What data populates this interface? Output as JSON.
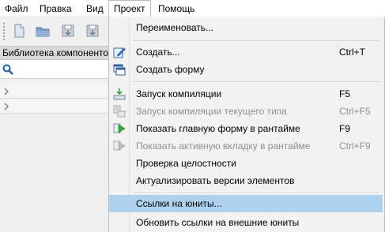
{
  "menubar": {
    "items": [
      {
        "label": "Файл"
      },
      {
        "label": "Правка"
      },
      {
        "label": "Вид"
      },
      {
        "label": "Проект"
      },
      {
        "label": "Помощь"
      }
    ]
  },
  "toolbar": {
    "buttons": [
      "new-file-icon",
      "open-folder-icon",
      "save-icon",
      "save-all-icon"
    ]
  },
  "library": {
    "title": "Библиотека компоненто",
    "search_value": "",
    "search_icon": "search-icon"
  },
  "project_menu": {
    "items": [
      {
        "label": "Переименовать...",
        "shortcut": "",
        "icon": "",
        "enabled": true
      },
      {
        "label": "Создать...",
        "shortcut": "Ctrl+T",
        "icon": "new-edit-icon",
        "enabled": true
      },
      {
        "label": "Создать форму",
        "shortcut": "",
        "icon": "new-form-icon",
        "enabled": true
      },
      {
        "label": "Запуск компиляции",
        "shortcut": "F5",
        "icon": "compile-icon",
        "enabled": true
      },
      {
        "label": "Запуск компиляции текущего типа",
        "shortcut": "Ctrl+F5",
        "icon": "compile-current-icon",
        "enabled": false
      },
      {
        "label": "Показать главную форму в рантайме",
        "shortcut": "F9",
        "icon": "run-main-form-icon",
        "enabled": true
      },
      {
        "label": "Показать активную вкладку в рантайме",
        "shortcut": "Ctrl+F9",
        "icon": "run-active-tab-icon",
        "enabled": false
      },
      {
        "label": "Проверка целостности",
        "shortcut": "",
        "icon": "",
        "enabled": true
      },
      {
        "label": "Актуализировать версии элементов",
        "shortcut": "",
        "icon": "",
        "enabled": true
      },
      {
        "label": "Ссылки на юниты...",
        "shortcut": "",
        "icon": "",
        "enabled": true
      },
      {
        "label": "Обновить ссылки на внешние юниты",
        "shortcut": "",
        "icon": "",
        "enabled": true
      }
    ]
  },
  "colors": {
    "highlight": "#aed1ee",
    "disabled_text": "#8f8f8f"
  }
}
